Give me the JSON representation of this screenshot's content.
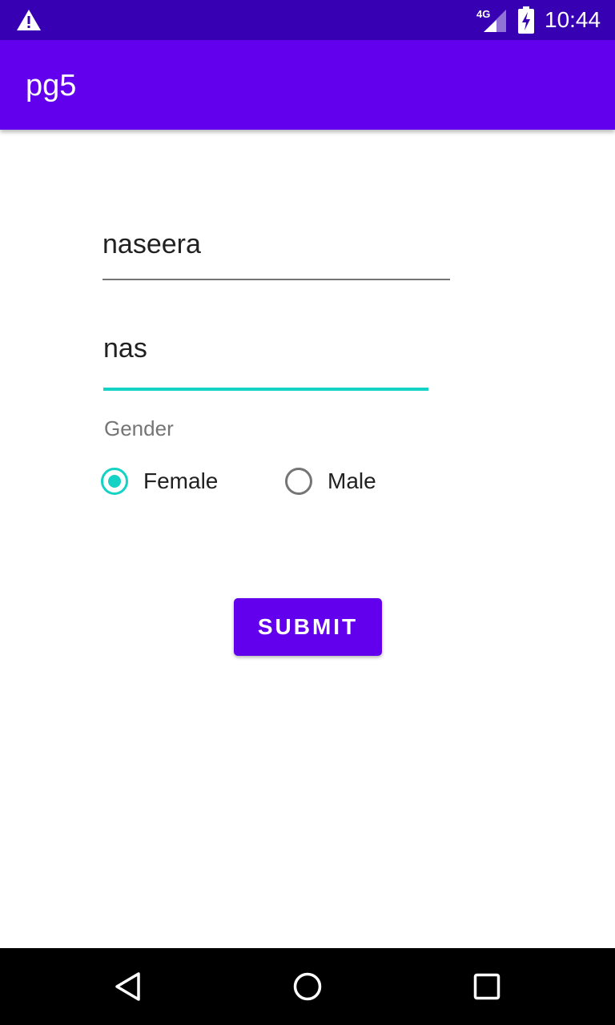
{
  "status_bar": {
    "time": "10:44",
    "network": "4G",
    "background_color": "#3700b3",
    "icons": [
      "warning-icon",
      "signal-icon",
      "battery-charging-icon"
    ]
  },
  "app_bar": {
    "title": "pg5",
    "background_color": "#6200ee"
  },
  "form": {
    "name_value": "naseera",
    "password_value": "nas",
    "accent_color": "#14d2c4",
    "gender_label": "Gender",
    "gender_options": [
      {
        "label": "Female",
        "checked": true
      },
      {
        "label": "Male",
        "checked": false
      }
    ],
    "submit_label": "SUBMIT"
  },
  "nav_bar": {
    "icons": [
      "back-icon",
      "home-icon",
      "recents-icon"
    ]
  }
}
